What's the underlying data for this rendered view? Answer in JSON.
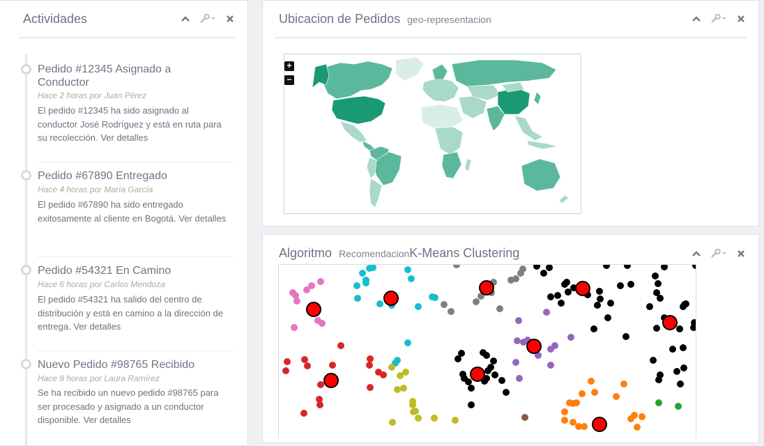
{
  "activities_panel": {
    "title": "Actividades",
    "items": [
      {
        "title": "Pedido #12345 Asignado a Conductor",
        "meta": "Hace 2 horas por Juan Pérez",
        "body": "El pedido #12345 ha sido asignado al conductor José Rodríguez y está en ruta para su recolección.",
        "link": "Ver detalles"
      },
      {
        "title": "Pedido #67890 Entregado",
        "meta": "Hace 4 horas por María García",
        "body": "El pedido #67890 ha sido entregado exitosamente al cliente en Bogotá.",
        "link": "Ver detalles"
      },
      {
        "title": "Pedido #54321 En Camino",
        "meta": "Hace 6 horas por Carlos Mendoza",
        "body": "El pedido #54321 ha salido del centro de distribución y está en camino a la dirección de entrega.",
        "link": "Ver detalles"
      },
      {
        "title": "Nuevo Pedido #98765 Recibido",
        "meta": "Hace 8 horas por Laura Ramírez",
        "body": "Se ha recibido un nuevo pedido #98765 para ser procesado y asignado a un conductor disponible.",
        "link": "Ver detalles"
      }
    ]
  },
  "map_panel": {
    "title": "Ubicacion de Pedidos",
    "subtitle": "geo-representacion",
    "zoom_in": "+",
    "zoom_out": "−",
    "colors": {
      "dark": "#1a9a74",
      "mid": "#5bb89d",
      "light": "#a8d9c9",
      "pale": "#d8eee6"
    }
  },
  "algorithm_panel": {
    "title": "Algoritmo",
    "subtitle": "Recomendacion",
    "chart_title": "K-Means Clustering",
    "chart_data": {
      "type": "scatter",
      "centroid_color": "#ff0000",
      "clusters": [
        {
          "color": "#e377c2",
          "centroid": [
            50,
            64
          ],
          "points": [
            [
              20,
              40
            ],
            [
              24,
              44
            ],
            [
              26,
              52
            ],
            [
              56,
              80
            ],
            [
              62,
              84
            ],
            [
              22,
              90
            ],
            [
              40,
              36
            ],
            [
              47,
              30
            ],
            [
              60,
              24
            ]
          ]
        },
        {
          "color": "#17becf",
          "centroid": [
            161,
            48
          ],
          "points": [
            [
              112,
              30
            ],
            [
              125,
              26
            ],
            [
              113,
              48
            ],
            [
              130,
              5
            ],
            [
              135,
              4
            ],
            [
              120,
              12
            ],
            [
              125,
              22
            ],
            [
              145,
              56
            ],
            [
              162,
              58
            ],
            [
              185,
              7
            ],
            [
              190,
              20
            ],
            [
              200,
              60
            ],
            [
              220,
              46
            ],
            [
              224,
              47
            ],
            [
              185,
              112
            ],
            [
              167,
              141
            ],
            [
              170,
              137
            ]
          ]
        },
        {
          "color": "#7f7f7f",
          "centroid": null,
          "points": [
            [
              255,
              0
            ],
            [
              237,
              57
            ],
            [
              247,
              67
            ],
            [
              283,
              53
            ],
            [
              290,
              45
            ],
            [
              305,
              40
            ],
            [
              293,
              31
            ],
            [
              308,
              25
            ],
            [
              333,
              22
            ],
            [
              340,
              20
            ],
            [
              347,
              12
            ],
            [
              350,
              6
            ],
            [
              317,
              63
            ]
          ]
        },
        {
          "color": "#000000",
          "centroid": [
            298,
            33
          ],
          "points": [
            [
              370,
              2
            ],
            [
              388,
              4
            ],
            [
              380,
              12
            ],
            [
              410,
              28
            ],
            [
              413,
              25
            ],
            [
              400,
              44
            ],
            [
              415,
              39
            ],
            [
              423,
              33
            ],
            [
              405,
              55
            ],
            [
              390,
              46
            ],
            [
              433,
              33
            ],
            [
              460,
              38
            ],
            [
              470,
              1
            ],
            [
              500,
              1
            ],
            [
              505,
              28
            ],
            [
              490,
              30
            ],
            [
              540,
              16
            ],
            [
              544,
              27
            ],
            [
              542,
              40
            ],
            [
              553,
              3
            ],
            [
              598,
              1
            ],
            [
              584,
              56
            ],
            [
              582,
              57
            ],
            [
              580,
              60
            ],
            [
              553,
              76
            ],
            [
              575,
              92
            ],
            [
              596,
              83
            ],
            [
              595,
              90
            ],
            [
              581,
              148
            ],
            [
              576,
              171
            ],
            [
              542,
              91
            ],
            [
              565,
              121
            ],
            [
              537,
              137
            ],
            [
              547,
              158
            ],
            [
              545,
              165
            ],
            [
              547,
              48
            ],
            [
              532,
              60
            ],
            [
              461,
              49
            ],
            [
              472,
              76
            ],
            [
              457,
              58
            ],
            [
              476,
              55
            ],
            [
              443,
              43
            ],
            [
              452,
              92
            ],
            [
              498,
              103
            ],
            [
              580,
              119
            ],
            [
              571,
              153
            ]
          ]
        },
        {
          "color": "#000000",
          "centroid": [
            285,
            157
          ],
          "points": [
            [
              257,
              135
            ],
            [
              262,
              127
            ],
            [
              264,
              157
            ],
            [
              266,
              163
            ],
            [
              272,
              168
            ],
            [
              276,
              177
            ],
            [
              276,
              201
            ],
            [
              293,
              126
            ],
            [
              298,
              130
            ],
            [
              300,
              152
            ],
            [
              304,
              147
            ],
            [
              308,
              138
            ],
            [
              298,
              163
            ],
            [
              295,
              167
            ],
            [
              310,
              158
            ],
            [
              320,
              166
            ],
            [
              326,
              183
            ]
          ]
        },
        {
          "color": "#000000",
          "centroid": [
            436,
            34
          ],
          "points": []
        },
        {
          "color": "#000000",
          "centroid": [
            561,
            83
          ],
          "points": []
        },
        {
          "color": "#9467bd",
          "centroid": [
            366,
            117
          ],
          "points": [
            [
              344,
              80
            ],
            [
              342,
              109
            ],
            [
              351,
              111
            ],
            [
              357,
              108
            ],
            [
              372,
              130
            ],
            [
              340,
              140
            ],
            [
              345,
              163
            ],
            [
              390,
              144
            ],
            [
              390,
              121
            ],
            [
              396,
              116
            ],
            [
              419,
              104
            ],
            [
              384,
              68
            ]
          ]
        },
        {
          "color": "#d62728",
          "centroid": [
            75,
            166
          ],
          "points": [
            [
              12,
              139
            ],
            [
              10,
              152
            ],
            [
              37,
              136
            ],
            [
              41,
              145
            ],
            [
              77,
              144
            ],
            [
              89,
              116
            ],
            [
              131,
              135
            ],
            [
              130,
              144
            ],
            [
              143,
              154
            ],
            [
              150,
              158
            ],
            [
              131,
              176
            ],
            [
              60,
              172
            ],
            [
              58,
              193
            ],
            [
              59,
              201
            ],
            [
              36,
              213
            ]
          ]
        },
        {
          "color": "#bcbd22",
          "centroid": null,
          "points": [
            [
              162,
              147
            ],
            [
              182,
              154
            ],
            [
              174,
              159
            ],
            [
              179,
              177
            ],
            [
              170,
              179
            ],
            [
              192,
              196
            ],
            [
              192,
              201
            ],
            [
              196,
              210
            ],
            [
              193,
              211
            ],
            [
              200,
              220
            ],
            [
              223,
              220
            ],
            [
              253,
              223
            ],
            [
              163,
              226
            ]
          ]
        },
        {
          "color": "#ff7f0e",
          "centroid": [
            460,
            229
          ],
          "points": [
            [
              448,
              167
            ],
            [
              435,
              185
            ],
            [
              453,
              183
            ],
            [
              495,
              171
            ],
            [
              484,
              189
            ],
            [
              417,
              198
            ],
            [
              422,
              199
            ],
            [
              427,
              198
            ],
            [
              410,
              211
            ],
            [
              410,
              223
            ],
            [
              422,
              226
            ],
            [
              430,
              232
            ],
            [
              438,
              232
            ],
            [
              510,
              216
            ],
            [
              521,
              218
            ],
            [
              505,
              221
            ],
            [
              514,
              233
            ]
          ]
        },
        {
          "color": "#8c564b",
          "centroid": null,
          "points": [
            [
              353,
              219
            ]
          ]
        },
        {
          "color": "#2ca02c",
          "centroid": null,
          "points": [
            [
              545,
              198
            ],
            [
              573,
              203
            ]
          ]
        }
      ]
    }
  }
}
